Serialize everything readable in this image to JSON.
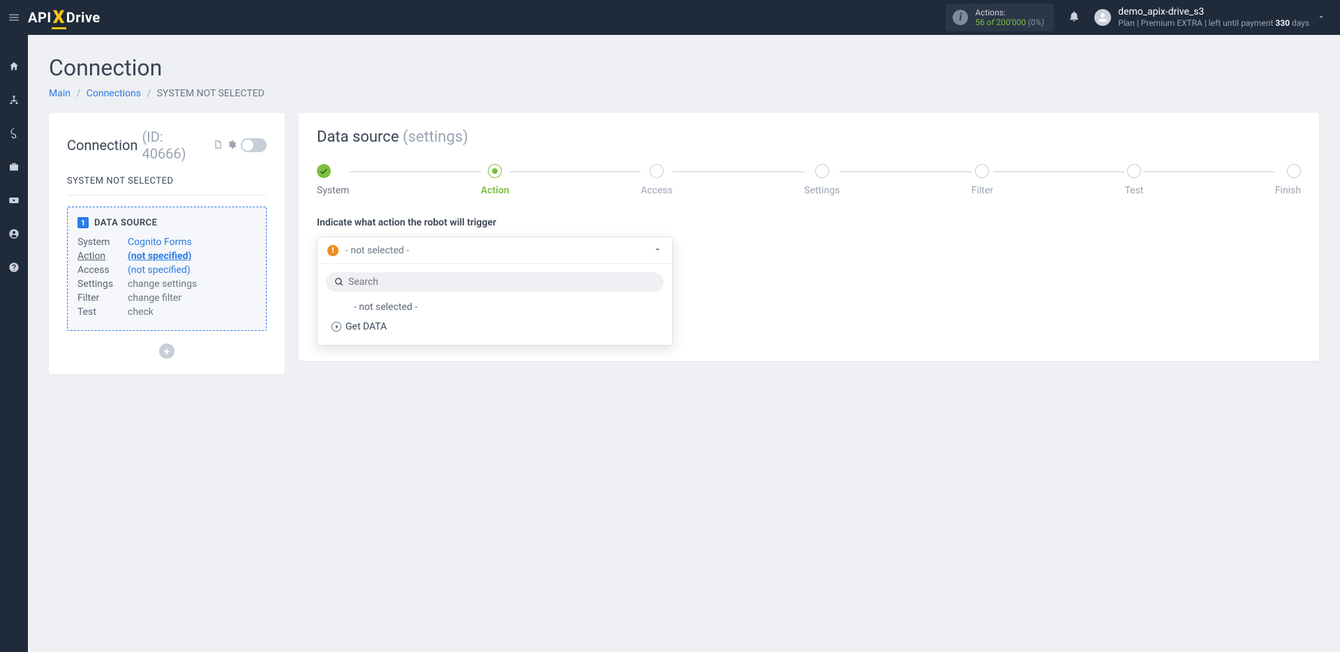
{
  "header": {
    "logo_api": "API",
    "logo_drive": "Drive",
    "actions_label": "Actions:",
    "actions_used": "56",
    "actions_of": "of",
    "actions_total": "200'000",
    "actions_pct": "(0%)",
    "username": "demo_apix-drive_s3",
    "plan_prefix": "Plan |",
    "plan_name": "Premium EXTRA",
    "plan_suffix": "| left until payment",
    "plan_days": "330",
    "plan_days_word": "days"
  },
  "page": {
    "title": "Connection",
    "breadcrumb": {
      "main": "Main",
      "connections": "Connections",
      "current": "SYSTEM NOT SELECTED"
    }
  },
  "conn_card": {
    "title": "Connection",
    "id_label": "(ID: 40666)",
    "subtitle": "SYSTEM NOT SELECTED",
    "datasource_label": "DATA SOURCE",
    "rows": {
      "system_k": "System",
      "system_v": "Cognito Forms",
      "action_k": "Action",
      "action_v": "(not specified)",
      "access_k": "Access",
      "access_v": "(not specified)",
      "settings_k": "Settings",
      "settings_v": "change settings",
      "filter_k": "Filter",
      "filter_v": "change filter",
      "test_k": "Test",
      "test_v": "check"
    }
  },
  "main_card": {
    "title": "Data source",
    "title_muted": "(settings)",
    "steps": {
      "system": "System",
      "action": "Action",
      "access": "Access",
      "settings": "Settings",
      "filter": "Filter",
      "test": "Test",
      "finish": "Finish"
    },
    "field_label": "Indicate what action the robot will trigger",
    "dropdown": {
      "selected": "- not selected -",
      "search_placeholder": "Search",
      "opt_not_selected": "- not selected -",
      "opt_get_data": "Get DATA"
    }
  }
}
